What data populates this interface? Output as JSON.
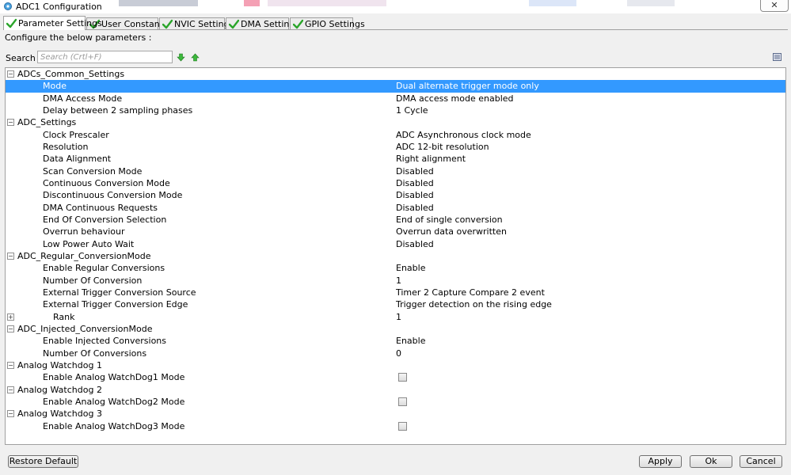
{
  "window": {
    "title": "ADC1 Configuration",
    "close_label": "✕"
  },
  "tabs": [
    {
      "label": "Parameter Settings",
      "active": true
    },
    {
      "label": "User Constants",
      "active": false
    },
    {
      "label": "NVIC Settings",
      "active": false
    },
    {
      "label": "DMA Settings",
      "active": false
    },
    {
      "label": "GPIO Settings",
      "active": false
    }
  ],
  "configure_label": "Configure the below parameters :",
  "search": {
    "label": "Search :",
    "placeholder": "Search (Crtl+F)"
  },
  "icons": {
    "check": "check-icon",
    "arrow_down": "arrow-down-icon",
    "arrow_up": "arrow-up-icon",
    "list_view": "list-view-icon",
    "accent": "#3399ff",
    "check_color": "#2aa52a"
  },
  "tree": {
    "adcs_common": {
      "title": "ADCs_Common_Settings",
      "mode": {
        "name": "Mode",
        "value": "Dual alternate trigger mode only"
      },
      "dma_access": {
        "name": "DMA Access Mode",
        "value": "DMA access mode enabled"
      },
      "delay": {
        "name": "Delay between 2 sampling phases",
        "value": "1 Cycle"
      }
    },
    "adc_settings": {
      "title": "ADC_Settings",
      "clock_prescaler": {
        "name": "Clock Prescaler",
        "value": "ADC Asynchronous clock mode"
      },
      "resolution": {
        "name": "Resolution",
        "value": "ADC 12-bit resolution"
      },
      "data_alignment": {
        "name": "Data Alignment",
        "value": "Right alignment"
      },
      "scan_mode": {
        "name": "Scan Conversion Mode",
        "value": "Disabled"
      },
      "continuous_mode": {
        "name": "Continuous Conversion Mode",
        "value": "Disabled"
      },
      "discontinuous_mode": {
        "name": "Discontinuous Conversion Mode",
        "value": "Disabled"
      },
      "dma_requests": {
        "name": "DMA Continuous Requests",
        "value": "Disabled"
      },
      "eoc_selection": {
        "name": "End Of Conversion Selection",
        "value": "End of single conversion"
      },
      "overrun": {
        "name": "Overrun behaviour",
        "value": "Overrun data overwritten"
      },
      "low_power": {
        "name": "Low Power Auto Wait",
        "value": "Disabled"
      }
    },
    "regular": {
      "title": "ADC_Regular_ConversionMode",
      "enable": {
        "name": "Enable Regular Conversions",
        "value": "Enable"
      },
      "number": {
        "name": "Number Of Conversion",
        "value": "1"
      },
      "trigger_source": {
        "name": "External Trigger Conversion Source",
        "value": "Timer 2 Capture Compare 2 event"
      },
      "trigger_edge": {
        "name": "External Trigger Conversion Edge",
        "value": "Trigger detection on the rising edge"
      },
      "rank": {
        "name": "Rank",
        "value": "1"
      }
    },
    "injected": {
      "title": "ADC_Injected_ConversionMode",
      "enable": {
        "name": "Enable Injected Conversions",
        "value": "Enable"
      },
      "number": {
        "name": "Number Of Conversions",
        "value": "0"
      }
    },
    "watchdog1": {
      "title": "Analog Watchdog 1",
      "enable": {
        "name": "Enable Analog WatchDog1 Mode",
        "checked": false
      }
    },
    "watchdog2": {
      "title": "Analog Watchdog 2",
      "enable": {
        "name": "Enable Analog WatchDog2 Mode",
        "checked": false
      }
    },
    "watchdog3": {
      "title": "Analog Watchdog 3",
      "enable": {
        "name": "Enable Analog WatchDog3 Mode",
        "checked": false
      }
    }
  },
  "buttons": {
    "restore": "Restore Default",
    "apply": "Apply",
    "ok": "Ok",
    "cancel": "Cancel"
  }
}
